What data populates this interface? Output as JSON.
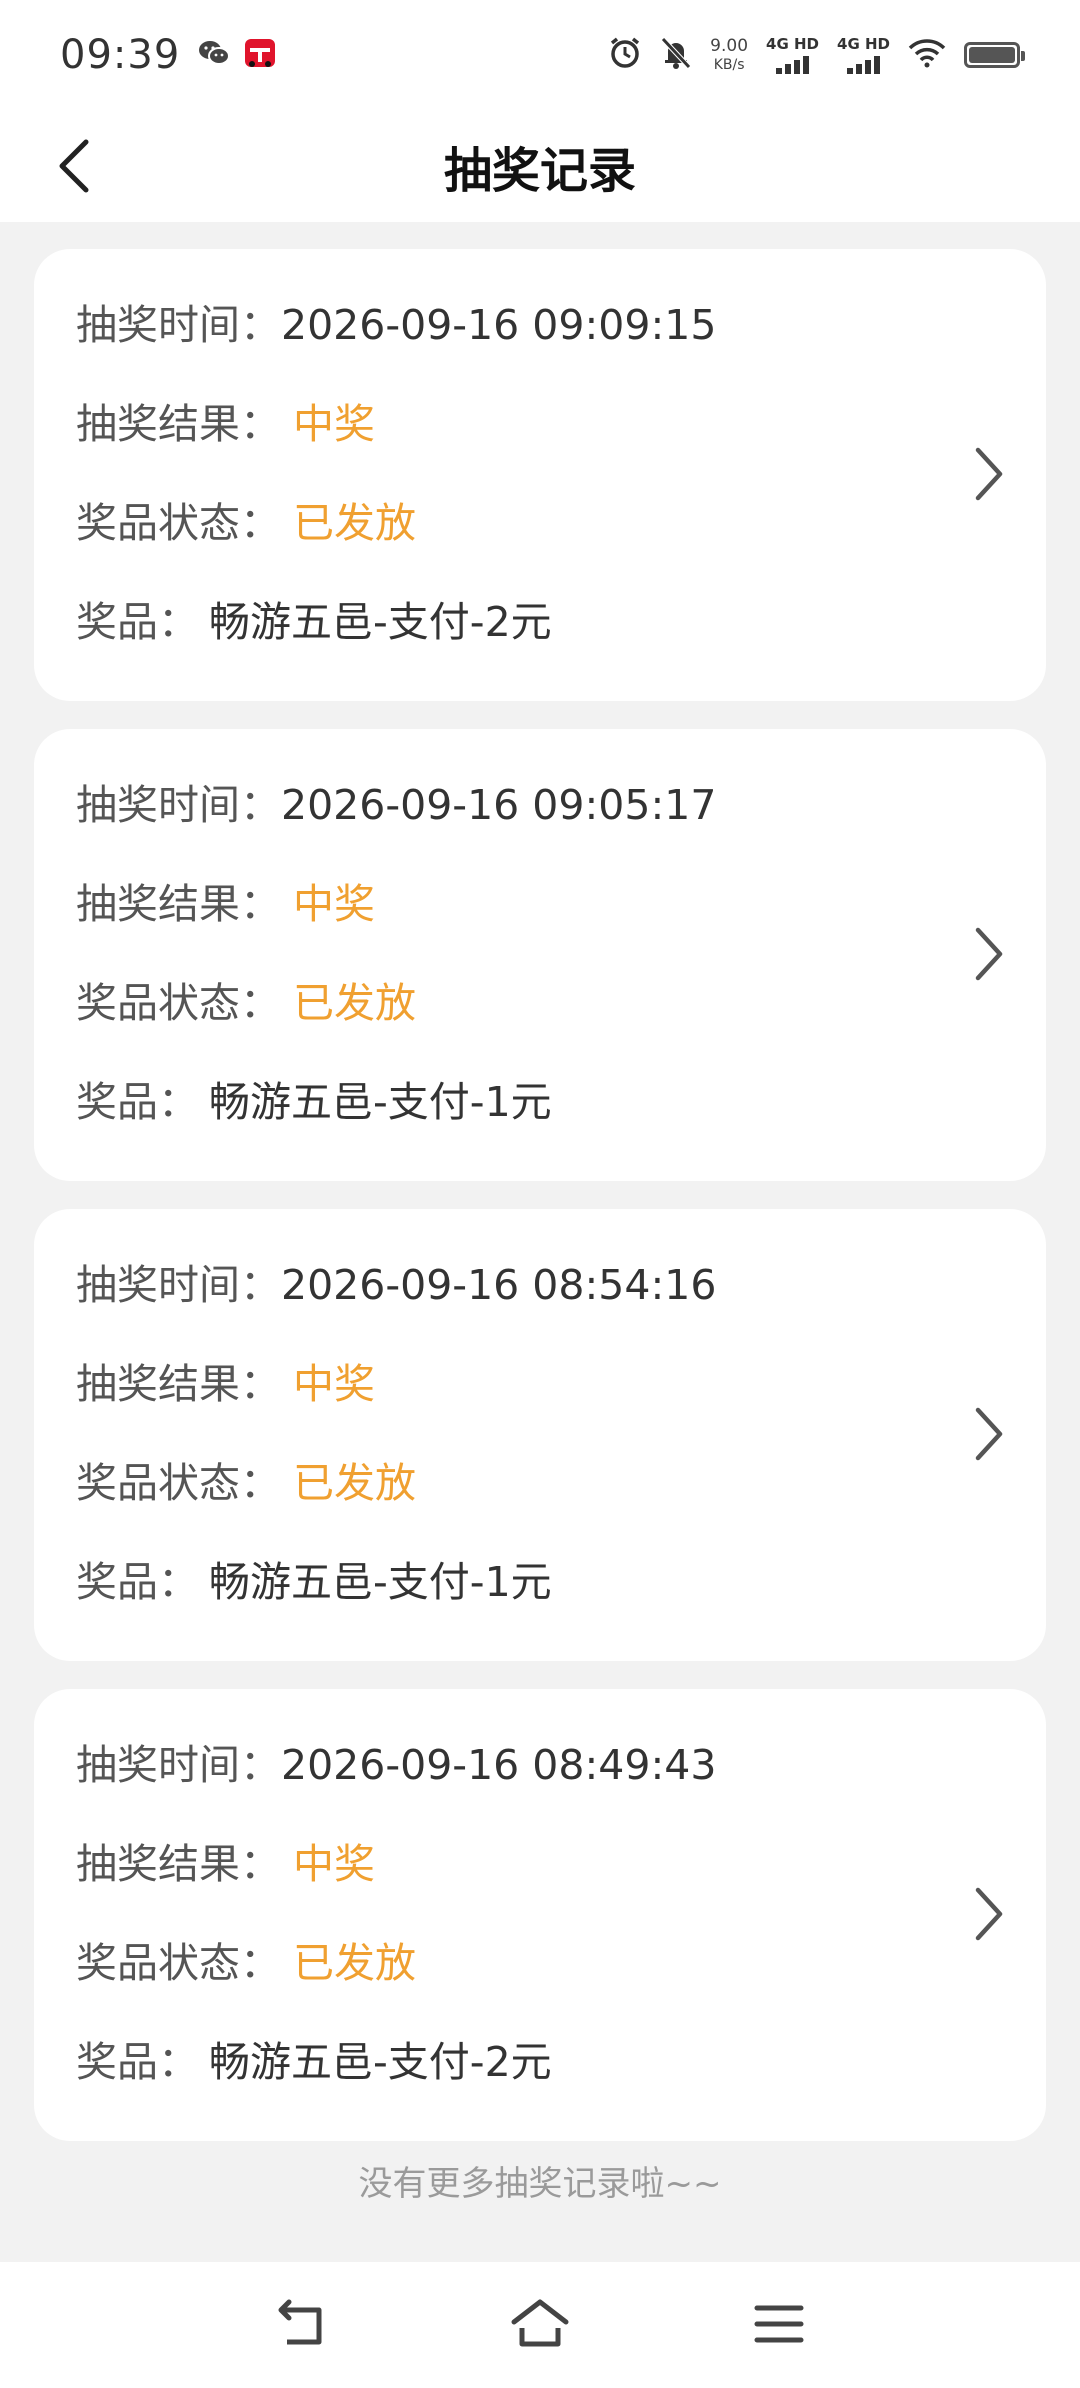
{
  "status_bar": {
    "time": "09:39",
    "speed_value": "9.00",
    "speed_unit": "KB/s",
    "net1": "4G HD",
    "net2": "4G HD",
    "icons": [
      "wechat-icon",
      "tmall-icon",
      "alarm-icon",
      "mute-bell-icon",
      "signal-icon",
      "wifi-icon",
      "battery-icon"
    ]
  },
  "header": {
    "title": "抽奖记录",
    "back_icon": "chevron-left-icon"
  },
  "records": [
    {
      "time_label": "抽奖时间：",
      "time_value": "2026-09-16 09:09:15",
      "result_label": "抽奖结果：",
      "result_value": "中奖",
      "status_label": "奖品状态：",
      "status_value": "已发放",
      "prize_label": "奖品：",
      "prize_value": "畅游五邑-支付-2元"
    },
    {
      "time_label": "抽奖时间：",
      "time_value": "2026-09-16 09:05:17",
      "result_label": "抽奖结果：",
      "result_value": "中奖",
      "status_label": "奖品状态：",
      "status_value": "已发放",
      "prize_label": "奖品：",
      "prize_value": "畅游五邑-支付-1元"
    },
    {
      "time_label": "抽奖时间：",
      "time_value": "2026-09-16 08:54:16",
      "result_label": "抽奖结果：",
      "result_value": "中奖",
      "status_label": "奖品状态：",
      "status_value": "已发放",
      "prize_label": "奖品：",
      "prize_value": "畅游五邑-支付-1元"
    },
    {
      "time_label": "抽奖时间：",
      "time_value": "2026-09-16 08:49:43",
      "result_label": "抽奖结果：",
      "result_value": "中奖",
      "status_label": "奖品状态：",
      "status_value": "已发放",
      "prize_label": "奖品：",
      "prize_value": "畅游五邑-支付-2元"
    }
  ],
  "footer_note": "没有更多抽奖记录啦~~",
  "colors": {
    "accent": "#f0a030",
    "background": "#f2f2f2",
    "card": "#ffffff"
  },
  "nav_bar": {
    "icons": [
      "back-nav-icon",
      "home-nav-icon",
      "menu-nav-icon"
    ]
  }
}
